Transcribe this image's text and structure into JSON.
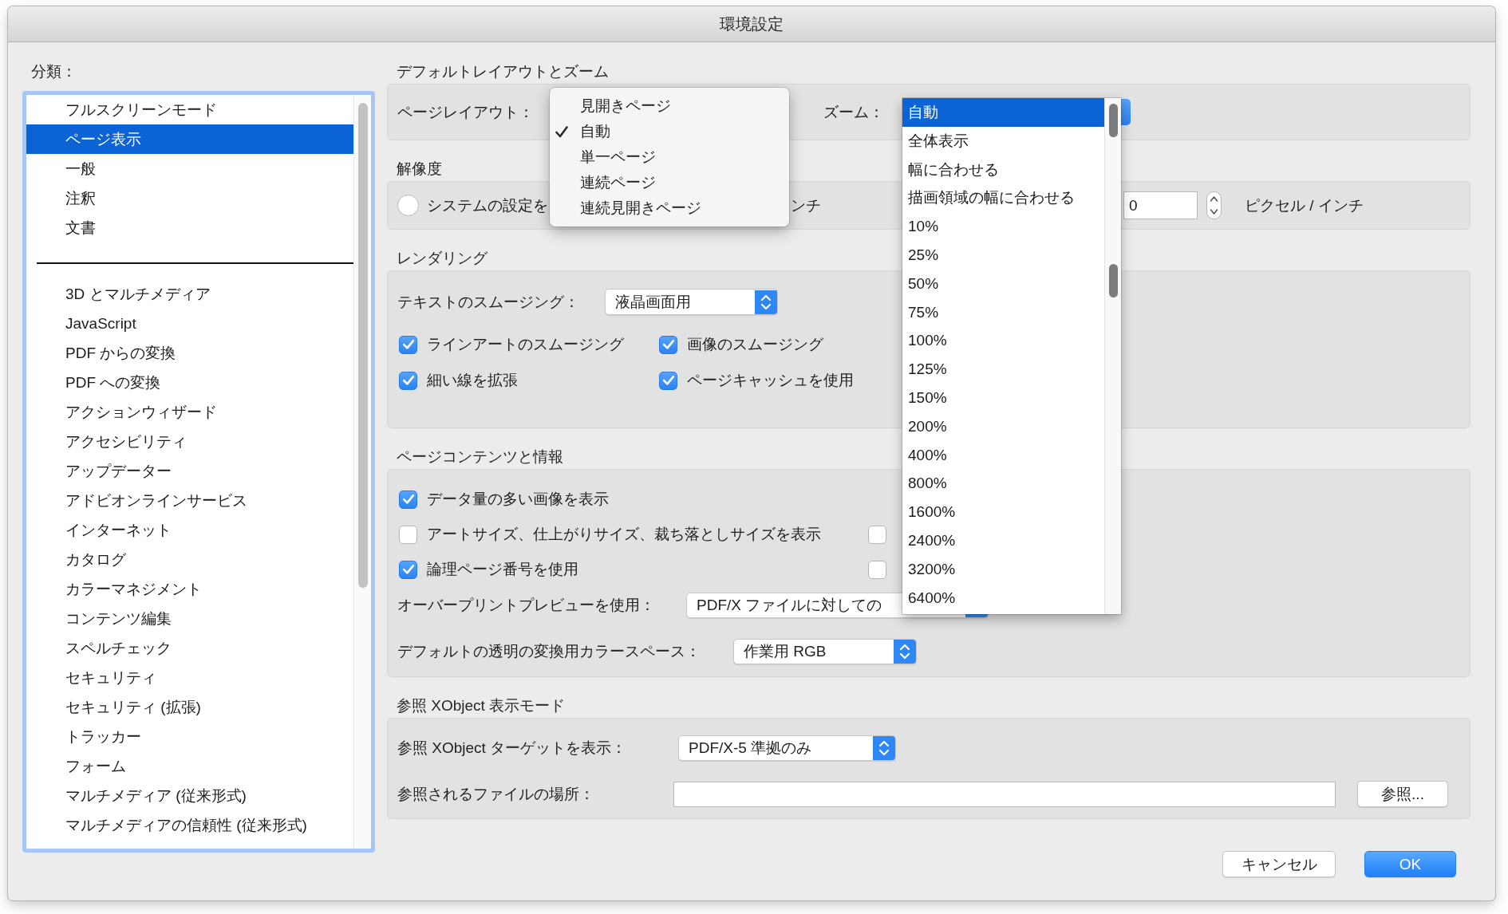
{
  "window": {
    "title": "環境設定"
  },
  "sidebar": {
    "label": "分類：",
    "groups": [
      {
        "items": [
          {
            "label": "フルスクリーンモード",
            "selected": false
          },
          {
            "label": "ページ表示",
            "selected": true
          },
          {
            "label": "一般",
            "selected": false
          },
          {
            "label": "注釈",
            "selected": false
          },
          {
            "label": "文書",
            "selected": false
          }
        ]
      },
      {
        "items": [
          {
            "label": "3D とマルチメディア",
            "selected": false
          },
          {
            "label": "JavaScript",
            "selected": false
          },
          {
            "label": "PDF からの変換",
            "selected": false
          },
          {
            "label": "PDF への変換",
            "selected": false
          },
          {
            "label": "アクションウィザード",
            "selected": false
          },
          {
            "label": "アクセシビリティ",
            "selected": false
          },
          {
            "label": "アップデーター",
            "selected": false
          },
          {
            "label": "アドビオンラインサービス",
            "selected": false
          },
          {
            "label": "インターネット",
            "selected": false
          },
          {
            "label": "カタログ",
            "selected": false
          },
          {
            "label": "カラーマネジメント",
            "selected": false
          },
          {
            "label": "コンテンツ編集",
            "selected": false
          },
          {
            "label": "スペルチェック",
            "selected": false
          },
          {
            "label": "セキュリティ",
            "selected": false
          },
          {
            "label": "セキュリティ (拡張)",
            "selected": false
          },
          {
            "label": "トラッカー",
            "selected": false
          },
          {
            "label": "フォーム",
            "selected": false
          },
          {
            "label": "マルチメディア (従来形式)",
            "selected": false
          },
          {
            "label": "マルチメディアの信頼性 (従来形式)",
            "selected": false
          }
        ]
      }
    ]
  },
  "layout_zoom": {
    "heading": "デフォルトレイアウトとズーム",
    "page_layout_label": "ページレイアウト：",
    "zoom_label": "ズーム："
  },
  "page_layout_menu": {
    "items": [
      {
        "label": "見開きページ",
        "selected": false
      },
      {
        "label": "自動",
        "selected": true
      },
      {
        "label": "単一ページ",
        "selected": false
      },
      {
        "label": "連続ページ",
        "selected": false
      },
      {
        "label": "連続見開きページ",
        "selected": false
      }
    ]
  },
  "zoom_list": {
    "items": [
      {
        "label": "自動",
        "selected": true
      },
      {
        "label": "全体表示",
        "selected": false
      },
      {
        "label": "幅に合わせる",
        "selected": false
      },
      {
        "label": "描画領域の幅に合わせる",
        "selected": false
      },
      {
        "label": "10%",
        "selected": false
      },
      {
        "label": "25%",
        "selected": false
      },
      {
        "label": "50%",
        "selected": false
      },
      {
        "label": "75%",
        "selected": false
      },
      {
        "label": "100%",
        "selected": false
      },
      {
        "label": "125%",
        "selected": false
      },
      {
        "label": "150%",
        "selected": false
      },
      {
        "label": "200%",
        "selected": false
      },
      {
        "label": "400%",
        "selected": false
      },
      {
        "label": "800%",
        "selected": false
      },
      {
        "label": "1600%",
        "selected": false
      },
      {
        "label": "2400%",
        "selected": false
      },
      {
        "label": "3200%",
        "selected": false
      },
      {
        "label": "6400%",
        "selected": false
      }
    ]
  },
  "resolution": {
    "heading": "解像度",
    "radio": {
      "label": "システムの設定を",
      "selected": false
    },
    "partial_label": "ンチ",
    "field": {
      "value": "0"
    },
    "unit": "ピクセル / インチ"
  },
  "rendering": {
    "heading": "レンダリング",
    "text_smoothing": {
      "label": "テキストのスムージング：",
      "value": "液晶画面用"
    },
    "checkbox_rows": [
      [
        {
          "label": "ラインアートのスムージング",
          "checked": true
        },
        {
          "label": "画像のスムージング",
          "checked": true
        }
      ],
      [
        {
          "label": "細い線を拡張",
          "checked": true
        },
        {
          "label": "ページキャッシュを使用",
          "checked": true
        }
      ]
    ]
  },
  "page_content": {
    "heading": "ページコンテンツと情報",
    "checkbox_rows": [
      [
        {
          "label": "データ量の多い画像を表示",
          "checked": true
        }
      ],
      [
        {
          "label": "アートサイズ、仕上がりサイズ、裁ち落としサイズを表示",
          "checked": false
        },
        {
          "checked": false
        }
      ],
      [
        {
          "label": "論理ページ番号を使用",
          "checked": true
        },
        {
          "checked": false
        }
      ]
    ],
    "overprint": {
      "label": "オーバープリントプレビューを使用：",
      "value": "PDF/X ファイルに対しての"
    },
    "transparency": {
      "label": "デフォルトの透明の変換用カラースペース：",
      "value": "作業用 RGB"
    }
  },
  "xobject": {
    "heading": "参照 XObject 表示モード",
    "target": {
      "label": "参照 XObject ターゲットを表示：",
      "value": "PDF/X-5 準拠のみ"
    },
    "location": {
      "label": "参照されるファイルの場所："
    },
    "browse_button": "参照..."
  },
  "buttons": [
    {
      "label": "キャンセル",
      "kind": "default"
    },
    {
      "label": "OK",
      "kind": "primary"
    }
  ]
}
